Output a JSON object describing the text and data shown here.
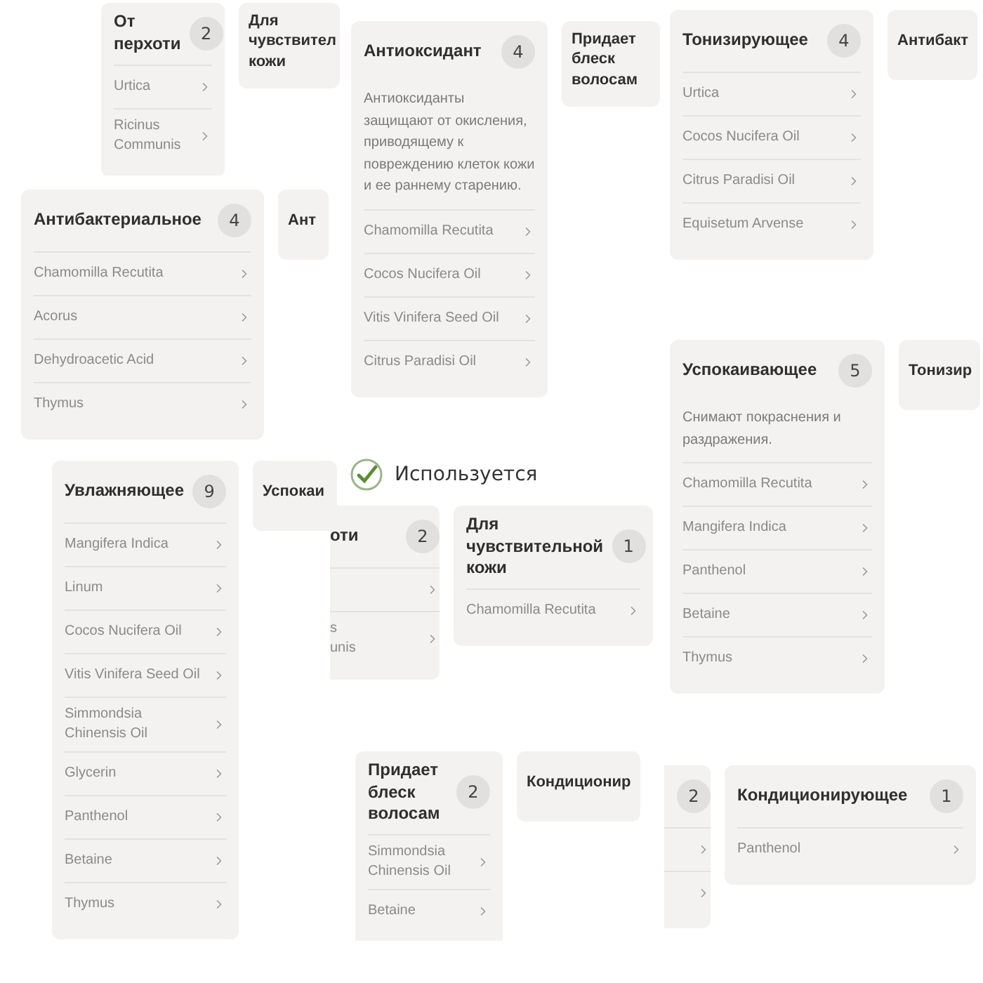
{
  "fragments": [
    {
      "cards": [
        {
          "kind": "expanded",
          "title": "От перхоти",
          "count": "2",
          "items": [
            {
              "name": "Urtica"
            },
            {
              "name": "Ricinus Communis"
            }
          ]
        },
        {
          "kind": "collapsed",
          "title": "Для чувствител кожи"
        }
      ]
    },
    {
      "cards": [
        {
          "kind": "expanded",
          "title": "Антибактериальное",
          "count": "4",
          "items": [
            {
              "name": "Chamomilla Recutita"
            },
            {
              "name": "Acorus"
            },
            {
              "name": "Dehydroacetic Acid"
            },
            {
              "name": "Thymus"
            }
          ]
        },
        {
          "kind": "collapsed",
          "title": "Ант"
        }
      ]
    },
    {
      "cards": [
        {
          "kind": "expanded",
          "title": "Антиоксидант",
          "count": "4",
          "description": "Антиоксиданты защищают от окисления, приводящему к повреждению клеток кожи и ее раннему старению.",
          "items": [
            {
              "name": "Chamomilla Recutita"
            },
            {
              "name": "Cocos Nucifera Oil"
            },
            {
              "name": "Vitis Vinifera Seed Oil"
            },
            {
              "name": "Citrus Paradisi Oil"
            }
          ]
        },
        {
          "kind": "collapsed",
          "title": "Придает блеск волосам"
        }
      ]
    },
    {
      "cards": [
        {
          "kind": "expanded",
          "title": "Тонизирующее",
          "count": "4",
          "items": [
            {
              "name": "Urtica"
            },
            {
              "name": "Cocos Nucifera Oil"
            },
            {
              "name": "Citrus Paradisi Oil"
            },
            {
              "name": "Equisetum Arvense"
            }
          ]
        },
        {
          "kind": "collapsed",
          "title": "Антибакт"
        }
      ]
    },
    {
      "cards": [
        {
          "kind": "expanded",
          "title": "Успокаивающее",
          "count": "5",
          "description": "Снимают покраснения и раздражения.",
          "items": [
            {
              "name": "Chamomilla Recutita"
            },
            {
              "name": "Mangifera Indica"
            },
            {
              "name": "Panthenol"
            },
            {
              "name": "Betaine"
            },
            {
              "name": "Thymus"
            }
          ]
        },
        {
          "kind": "collapsed",
          "title": "Тонизир"
        }
      ]
    },
    {
      "cards": [
        {
          "kind": "expanded",
          "title": "Увлажняющее",
          "count": "9",
          "items": [
            {
              "name": "Mangifera Indica"
            },
            {
              "name": "Linum"
            },
            {
              "name": "Cocos Nucifera Oil"
            },
            {
              "name": "Vitis Vinifera Seed Oil"
            },
            {
              "name": "Simmondsia Chinensis Oil"
            },
            {
              "name": "Glycerin"
            },
            {
              "name": "Panthenol"
            },
            {
              "name": "Betaine"
            },
            {
              "name": "Thymus"
            }
          ]
        },
        {
          "kind": "collapsed",
          "title": "Успокаи"
        }
      ]
    },
    {
      "heading": "Используется",
      "cards": [
        {
          "kind": "expanded",
          "title": "оти",
          "count": "2",
          "items": [
            {
              "chevron": true
            },
            {
              "lines": [
                "s",
                "unis"
              ],
              "chevron": true
            }
          ]
        },
        {
          "kind": "expanded",
          "title": "Для чувствительной кожи",
          "count": "1",
          "items": [
            {
              "name": "Chamomilla Recutita"
            }
          ]
        }
      ]
    },
    {
      "cards": [
        {
          "kind": "expanded",
          "title": "Придает блеск волосам",
          "count": "2",
          "items": [
            {
              "name": "Simmondsia Chinensis Oil"
            },
            {
              "name": "Betaine"
            }
          ]
        },
        {
          "kind": "collapsed",
          "title": "Кондиционир"
        }
      ]
    },
    {
      "cards": [
        {
          "kind": "expanded",
          "count": "2",
          "items": [
            {
              "chevron": true
            },
            {
              "chevron": true
            }
          ]
        },
        {
          "kind": "expanded",
          "title": "Кондиционирующее",
          "count": "1",
          "items": [
            {
              "name": "Panthenol"
            }
          ]
        }
      ]
    }
  ]
}
